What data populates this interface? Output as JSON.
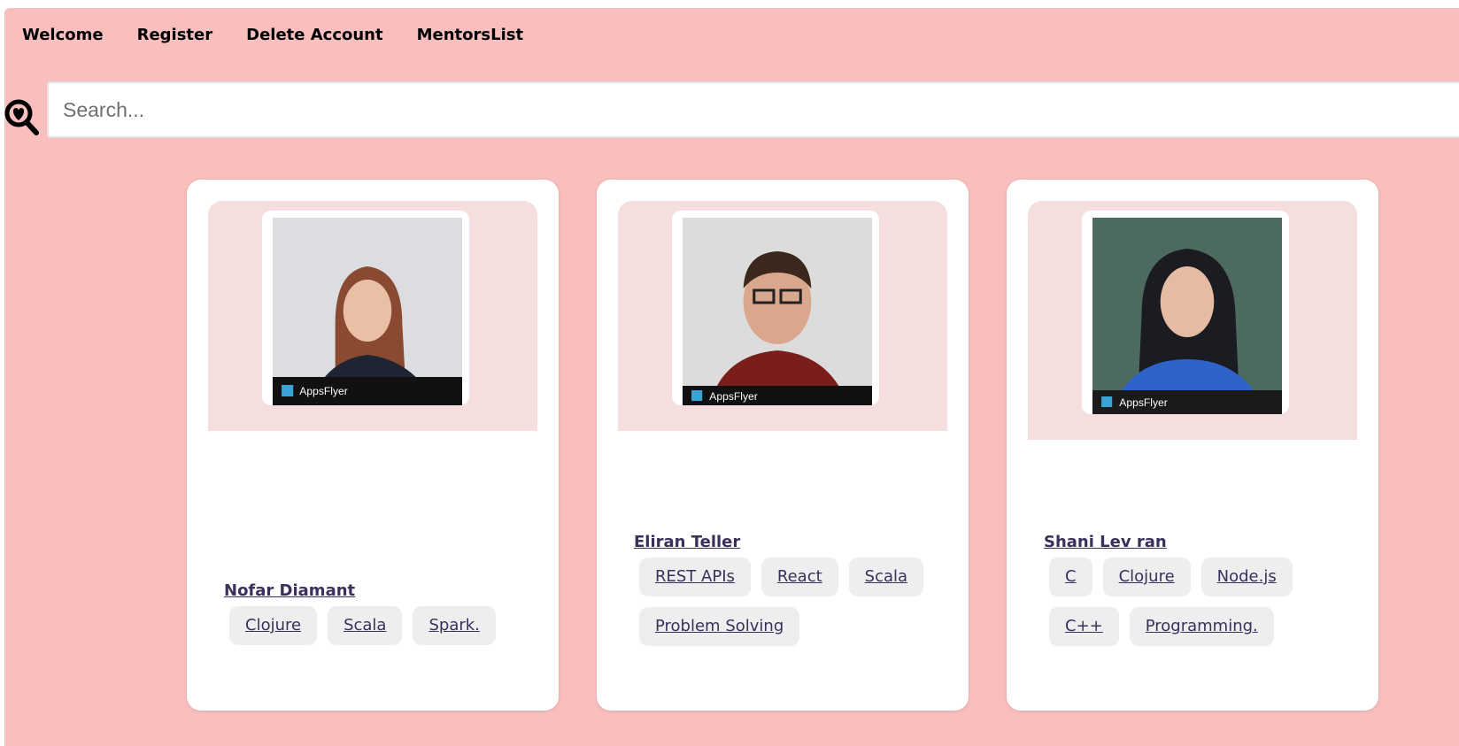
{
  "nav": {
    "items": [
      "Welcome",
      "Register",
      "Delete Account",
      "MentorsList"
    ]
  },
  "search": {
    "placeholder": "Search...",
    "value": ""
  },
  "mentors": [
    {
      "name": "Nofar Diamant",
      "tags": [
        "Clojure",
        "Scala",
        "Spark."
      ],
      "badge": "AppsFlyer"
    },
    {
      "name": "Eliran Teller",
      "tags": [
        "REST APIs",
        "React",
        "Scala",
        "Problem Solving"
      ],
      "badge": "AppsFlyer"
    },
    {
      "name": "Shani Lev ran",
      "tags": [
        "C",
        "Clojure",
        "Node.js",
        "C++",
        "Programming."
      ],
      "badge": "AppsFlyer"
    }
  ],
  "colors": {
    "background": "#f9bfbf",
    "card": "#ffffff",
    "image_area": "#f5dede",
    "tag_bg": "#eeeeee",
    "link": "#3b2f5c"
  }
}
